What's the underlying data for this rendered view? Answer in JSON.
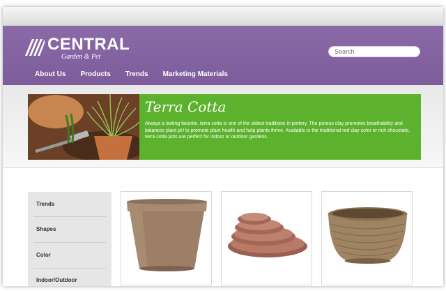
{
  "brand": {
    "name": "CENTRAL",
    "sub": "Garden & Pet"
  },
  "search": {
    "placeholder": "Search"
  },
  "nav": [
    {
      "label": "About Us"
    },
    {
      "label": "Products"
    },
    {
      "label": "Trends"
    },
    {
      "label": "Marketing Materials"
    }
  ],
  "hero": {
    "title": "Terra Cotta",
    "text": "Always a lasting favorite, terra cotta is one of the oldest traditions in pottery. The porous clay promotes breathability and balances plant pH to promote plant health and help plants thrive. Available in the traditional red clay color or rich chocolate, terra cotta pots are perfect for indoor or outdoor gardens."
  },
  "sidebar": [
    {
      "label": "Trends"
    },
    {
      "label": "Shapes"
    },
    {
      "label": "Color"
    },
    {
      "label": "Indoor/Outdoor"
    }
  ],
  "colors": {
    "header": "#7d5c9b",
    "hero": "#5cb22c",
    "pot": "#9c7f66",
    "saucer": "#a86d5c",
    "wicker": "#9e8462"
  }
}
